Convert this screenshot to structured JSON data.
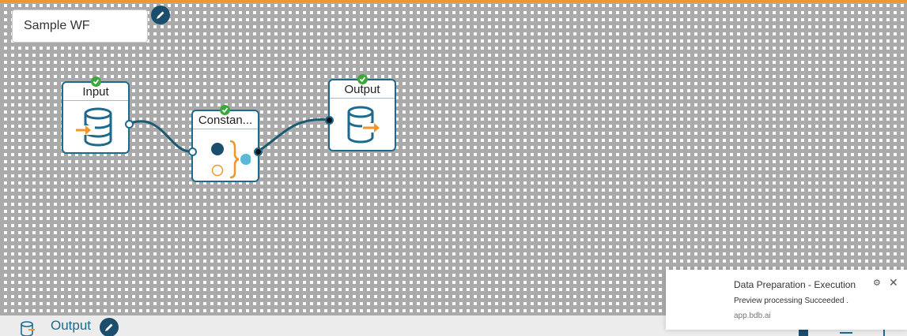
{
  "workflow": {
    "name": "Sample WF"
  },
  "nodes": [
    {
      "id": "input",
      "label": "Input",
      "status": "success",
      "icon": "database-in-icon"
    },
    {
      "id": "constant",
      "label": "Constan...",
      "status": "success",
      "icon": "constant-icon"
    },
    {
      "id": "output",
      "label": "Output",
      "status": "success",
      "icon": "database-out-icon"
    }
  ],
  "notification": {
    "title": "Data Preparation - Execution",
    "message": "Preview processing Succeeded .",
    "source": "app.bdb.ai"
  },
  "bottom_panel": {
    "title": "Output"
  },
  "colors": {
    "accent": "#1e6a8c",
    "brand_orange": "#f0962d",
    "success": "#3aa83a",
    "constant_dot": "#5bb8d6"
  }
}
